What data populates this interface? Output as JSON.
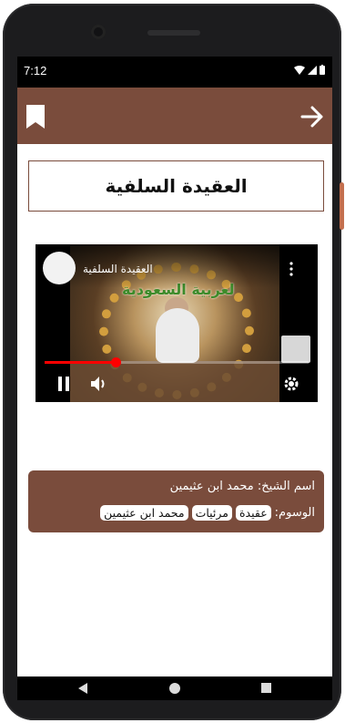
{
  "status": {
    "time": "7:12"
  },
  "page": {
    "title": "العقيدة السلفية"
  },
  "video": {
    "title": "العقيدة السلفية",
    "banner_text": "لعربية السعودية",
    "progress": 0.27,
    "progress_color": "#ff0000"
  },
  "info": {
    "sheikh_label": "اسم الشيخ:",
    "sheikh_name": "محمد ابن عثيمين",
    "tags_label": "الوسوم:",
    "tags": [
      "عقيدة",
      "مرئيات",
      "محمد ابن عثيمين"
    ]
  },
  "colors": {
    "brand": "#7a4c3c",
    "accent": "#c4704f"
  },
  "icons": [
    "bookmark-icon",
    "arrow-forward-icon",
    "pause-icon",
    "volume-icon",
    "settings-gear-icon",
    "more-vert-icon"
  ]
}
